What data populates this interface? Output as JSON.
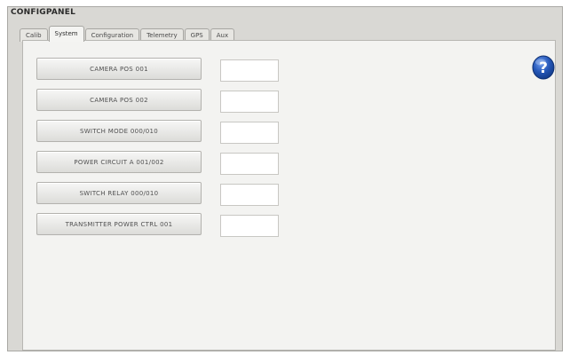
{
  "window": {
    "title": "CONFIGPANEL"
  },
  "tabs": [
    {
      "label": "Calib"
    },
    {
      "label": "System"
    },
    {
      "label": "Configuration"
    },
    {
      "label": "Telemetry"
    },
    {
      "label": "GPS"
    },
    {
      "label": "Aux"
    }
  ],
  "active_tab": "System",
  "buttons": [
    {
      "label": "CAMERA POS 001"
    },
    {
      "label": "CAMERA POS 002"
    },
    {
      "label": "SWITCH MODE 000/010"
    },
    {
      "label": "POWER CIRCUIT A 001/002"
    },
    {
      "label": "SWITCH RELAY 000/010"
    },
    {
      "label": "TRANSMITTER POWER CTRL 001"
    }
  ],
  "fields": [
    {
      "value": ""
    },
    {
      "value": ""
    },
    {
      "value": ""
    },
    {
      "value": ""
    },
    {
      "value": ""
    },
    {
      "value": ""
    }
  ],
  "help": {
    "icon": "help-icon",
    "glyph": "?",
    "color": "#2557b8"
  }
}
